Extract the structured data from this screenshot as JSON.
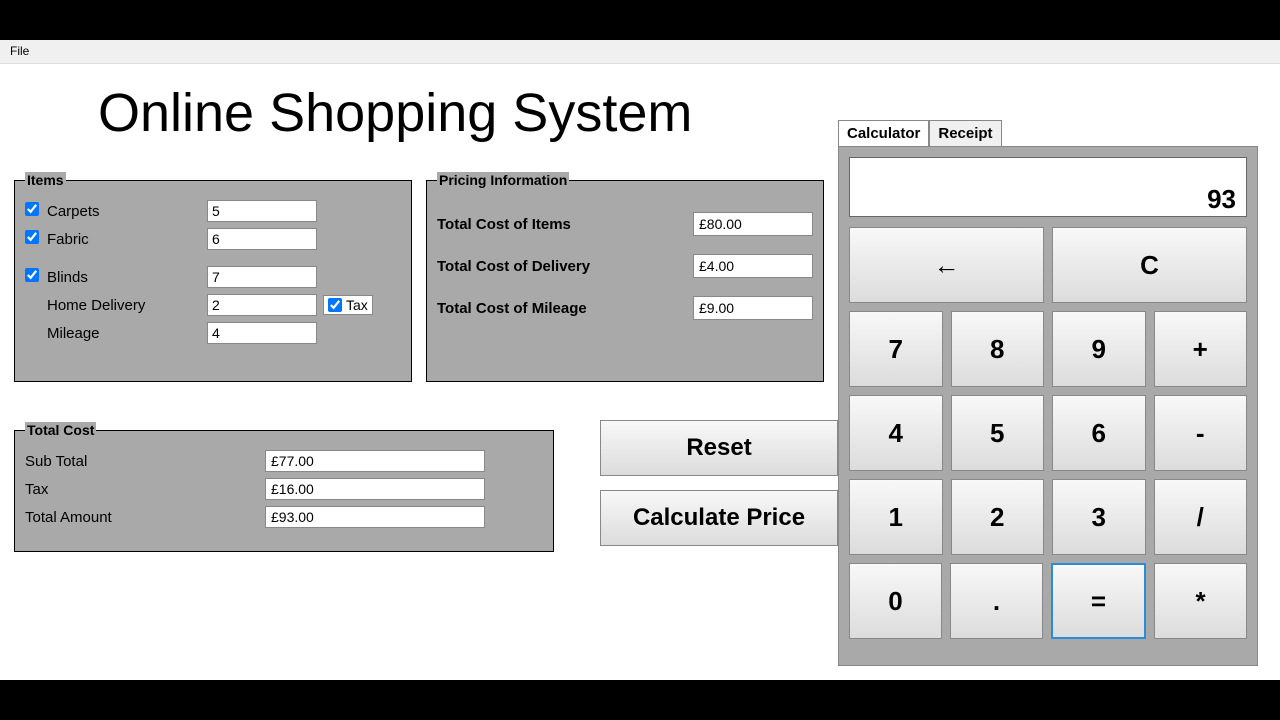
{
  "menu": {
    "file": "File"
  },
  "title": "Online Shopping System",
  "items": {
    "legend": "Items",
    "carpets": {
      "label": "Carpets",
      "checked": true,
      "qty": "5"
    },
    "fabric": {
      "label": "Fabric",
      "checked": true,
      "qty": "6"
    },
    "blinds": {
      "label": "Blinds",
      "checked": true,
      "qty": "7"
    },
    "homeDelivery": {
      "label": "Home Delivery",
      "qty": "2"
    },
    "tax": {
      "label": "Tax",
      "checked": true
    },
    "mileage": {
      "label": "Mileage",
      "qty": "4"
    }
  },
  "pricing": {
    "legend": "Pricing Information",
    "totalItems": {
      "label": "Total Cost of Items",
      "value": "£80.00"
    },
    "totalDelivery": {
      "label": "Total Cost of Delivery",
      "value": "£4.00"
    },
    "totalMileage": {
      "label": "Total Cost of Mileage",
      "value": "£9.00"
    }
  },
  "totals": {
    "legend": "Total Cost",
    "subTotal": {
      "label": "Sub Total",
      "value": "£77.00"
    },
    "tax": {
      "label": "Tax",
      "value": "£16.00"
    },
    "totalAmount": {
      "label": "Total Amount",
      "value": "£93.00"
    }
  },
  "actions": {
    "reset": "Reset",
    "calculate": "Calculate Price"
  },
  "calculator": {
    "tabs": {
      "calc": "Calculator",
      "receipt": "Receipt"
    },
    "display": "93",
    "backspace": "←",
    "clear": "C",
    "keys": {
      "7": "7",
      "8": "8",
      "9": "9",
      "plus": "+",
      "4": "4",
      "5": "5",
      "6": "6",
      "minus": "-",
      "1": "1",
      "2": "2",
      "3": "3",
      "div": "/",
      "0": "0",
      "dot": ".",
      "eq": "=",
      "mul": "*"
    }
  }
}
